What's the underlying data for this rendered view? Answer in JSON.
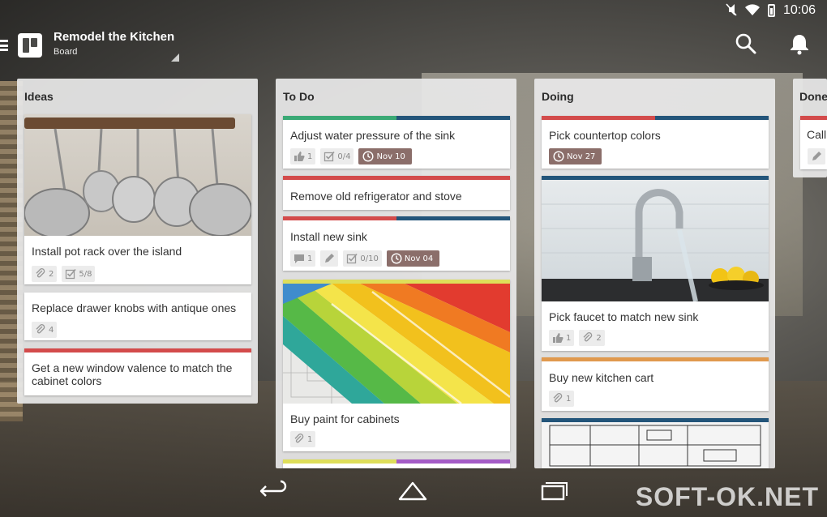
{
  "status": {
    "time": "10:06"
  },
  "header": {
    "title": "Remodel the Kitchen",
    "subtitle": "Board"
  },
  "colors": {
    "green": "#3aa975",
    "red": "#d34b4b",
    "blue": "#23557a",
    "orange": "#e0994e",
    "yellow": "#dede5a",
    "purple": "#a45cc6",
    "due": "#8b6e6a"
  },
  "lists": [
    {
      "name": "Ideas",
      "cards": [
        {
          "title": "Install pot rack over the island",
          "badges": {
            "attachments": "2",
            "checklist": "5/8"
          }
        },
        {
          "title": "Replace drawer knobs with antique ones",
          "badges": {
            "attachments": "4"
          }
        },
        {
          "title": "Get a new window valence to match the cabinet colors"
        }
      ]
    },
    {
      "name": "To Do",
      "cards": [
        {
          "title": "Adjust water pressure of the sink",
          "badges": {
            "votes": "1",
            "checklist": "0/4",
            "due": "Nov 10"
          }
        },
        {
          "title": "Remove old refrigerator and stove"
        },
        {
          "title": "Install new sink",
          "badges": {
            "comments": "1",
            "checklist": "0/10",
            "due": "Nov 04"
          }
        },
        {
          "title": "Buy paint for cabinets",
          "badges": {
            "attachments": "1"
          }
        }
      ]
    },
    {
      "name": "Doing",
      "cards": [
        {
          "title": "Pick countertop colors",
          "badges": {
            "due": "Nov 27"
          }
        },
        {
          "title": "Pick faucet to match new sink",
          "badges": {
            "votes": "1",
            "attachments": "2"
          }
        },
        {
          "title": "Buy new kitchen cart",
          "badges": {
            "attachments": "1"
          }
        }
      ]
    },
    {
      "name": "Done",
      "cards": [
        {
          "title": "Call"
        }
      ]
    }
  ],
  "watermark": "SOFT-OK.NET",
  "icons": {
    "menu": "menu-icon",
    "search": "search-icon",
    "notifications": "bell-icon",
    "back": "back-icon",
    "home": "home-icon",
    "recent": "recent-apps-icon"
  }
}
